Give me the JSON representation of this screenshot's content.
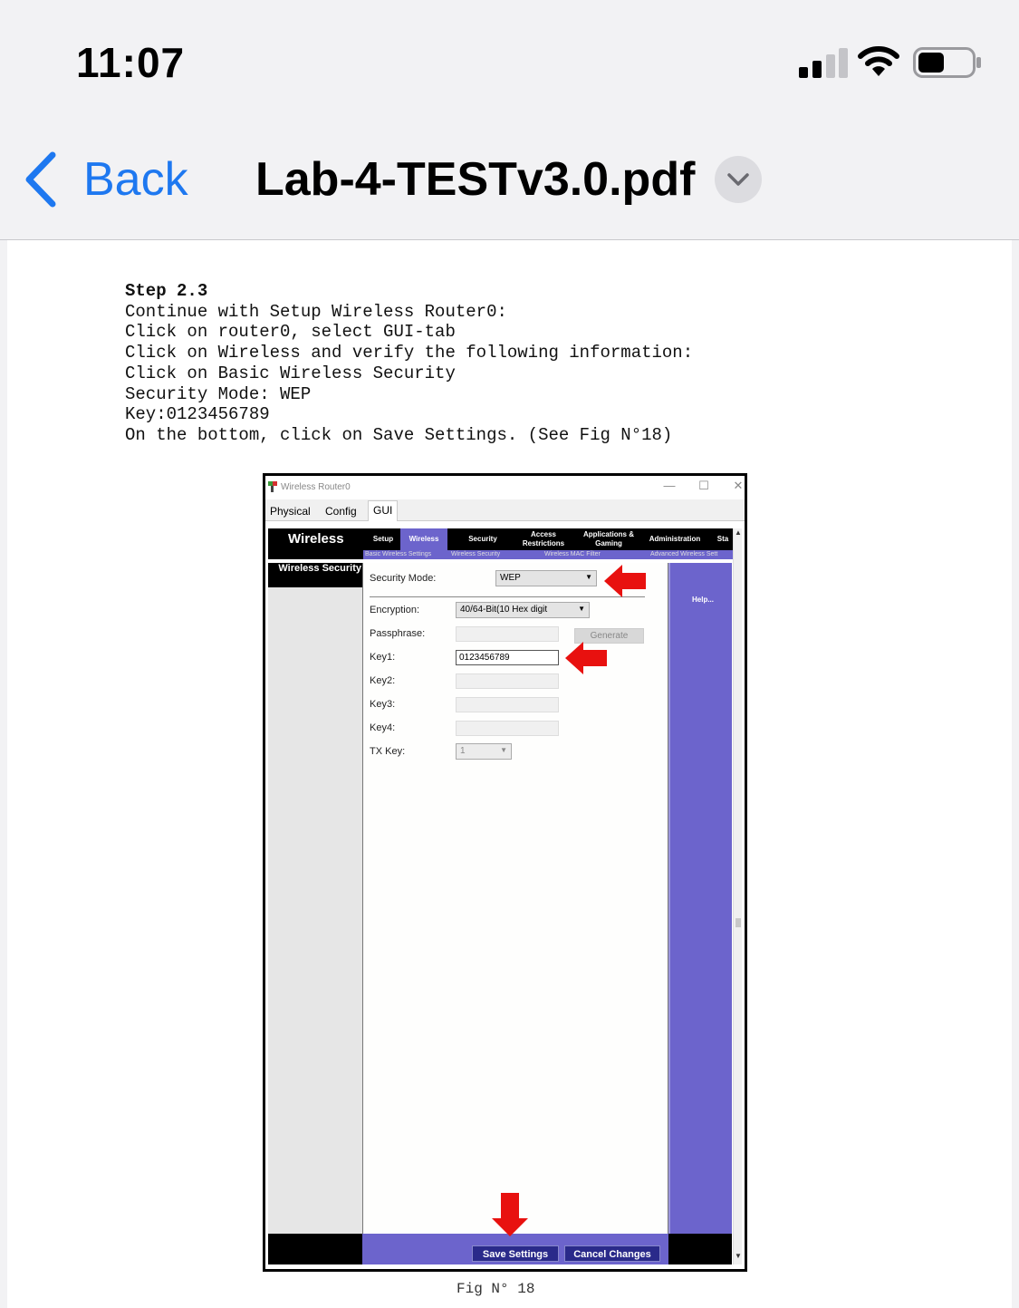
{
  "status_bar": {
    "time": "11:07"
  },
  "nav": {
    "back_label": "Back",
    "title": "Lab-4-TESTv3.0.pdf"
  },
  "instructions": {
    "heading": "Step 2.3",
    "lines": [
      "Continue with Setup Wireless Router0:",
      "Click on router0, select GUI-tab",
      "Click on Wireless and verify the following information:",
      "Click on Basic Wireless Security",
      "Security Mode: WEP",
      "Key:0123456789",
      "On the bottom, click on Save Settings. (See Fig N°18)"
    ]
  },
  "figure": {
    "caption": "Fig N° 18",
    "window_title": "Wireless Router0",
    "window_controls": {
      "minimize": "—",
      "maximize": "☐",
      "close": "✕"
    },
    "tabs": [
      "Physical",
      "Config",
      "GUI"
    ],
    "active_tab": "GUI",
    "brand": "Wireless",
    "menu": [
      {
        "label": "Setup"
      },
      {
        "label": "Wireless"
      },
      {
        "label": "Security"
      },
      {
        "label": "Access Restrictions"
      },
      {
        "label": "Applications & Gaming"
      },
      {
        "label": "Administration"
      },
      {
        "label": "Sta"
      }
    ],
    "active_menu": "Wireless",
    "submenu": [
      "Basic Wireless Settings",
      "Wireless Security",
      "Wireless MAC Filter",
      "Advanced Wireless Sett"
    ],
    "section_heading": "Wireless Security",
    "help_link": "Help...",
    "form": {
      "security_mode_label": "Security Mode:",
      "security_mode_value": "WEP",
      "encryption_label": "Encryption:",
      "encryption_value": "40/64-Bit(10 Hex digit",
      "passphrase_label": "Passphrase:",
      "passphrase_value": "",
      "generate_label": "Generate",
      "key1_label": "Key1:",
      "key1_value": "0123456789",
      "key2_label": "Key2:",
      "key3_label": "Key3:",
      "key4_label": "Key4:",
      "tx_key_label": "TX Key:",
      "tx_key_value": "1"
    },
    "buttons": {
      "save": "Save Settings",
      "cancel": "Cancel Changes"
    },
    "annotation_color": "#e8110f",
    "accent_color": "#6c64cc"
  }
}
